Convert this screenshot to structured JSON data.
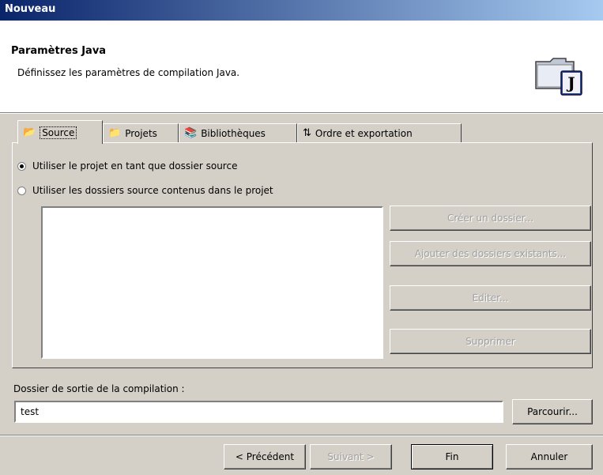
{
  "window": {
    "title": "Nouveau"
  },
  "header": {
    "title": "Paramètres Java",
    "description": "Définissez les paramètres de compilation Java.",
    "icon": "java-settings-icon"
  },
  "tabs": [
    {
      "label": "Source",
      "icon": "folder-open-icon",
      "active": true
    },
    {
      "label": "Projets",
      "icon": "projects-folder-icon",
      "active": false
    },
    {
      "label": "Bibliothèques",
      "icon": "libraries-icon",
      "active": false
    },
    {
      "label": "Ordre et exportation",
      "icon": "order-arrows-icon",
      "active": false
    }
  ],
  "source_options": {
    "option1": {
      "label": "Utiliser le projet en tant que dossier source",
      "selected": true
    },
    "option2": {
      "label": "Utiliser les dossiers source contenus dans le projet",
      "selected": false
    }
  },
  "folder_buttons": {
    "create": "Créer un dossier...",
    "add_existing": "Ajouter des dossiers existants...",
    "edit": "Editer...",
    "remove": "Supprimer"
  },
  "output": {
    "label": "Dossier de sortie de la compilation :",
    "value": "test",
    "browse": "Parcourir..."
  },
  "footer": {
    "previous": "< Précédent",
    "next": "Suivant >",
    "finish": "Fin",
    "cancel": "Annuler"
  },
  "colors": {
    "title_bar_start": "#0a246a",
    "title_bar_end": "#a6caf0",
    "dialog_bg": "#d4d0c8"
  }
}
